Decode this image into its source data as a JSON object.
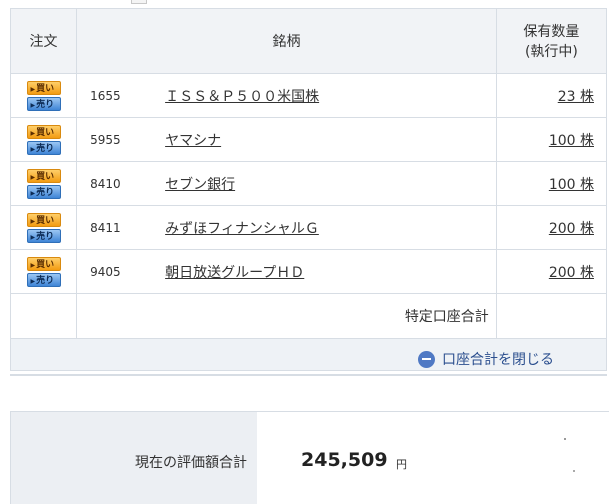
{
  "header": {
    "order": "注文",
    "name": "銘柄",
    "qty_line1": "保有数量",
    "qty_line2": "(執行中)"
  },
  "buttons": {
    "buy": "買い",
    "sell": "売り"
  },
  "rows": [
    {
      "code": "1655",
      "name": "ＩＳＳ＆Ｐ５００米国株",
      "qty": "23 株"
    },
    {
      "code": "5955",
      "name": "ヤマシナ",
      "qty": "100 株"
    },
    {
      "code": "8410",
      "name": "セブン銀行",
      "qty": "100 株"
    },
    {
      "code": "8411",
      "name": "みずほフィナンシャルＧ",
      "qty": "200 株"
    },
    {
      "code": "9405",
      "name": "朝日放送グループＨＤ",
      "qty": "200 株"
    }
  ],
  "total_label": "特定口座合計",
  "close_label": "口座合計を閉じる",
  "summary": {
    "label": "現在の評価額合計",
    "value": "245,509",
    "unit": "円"
  },
  "colors": {
    "buy": "#f39c12",
    "sell": "#3f85d6",
    "header_bg": "#f1f3f6",
    "close_icon": "#4f79c4"
  }
}
